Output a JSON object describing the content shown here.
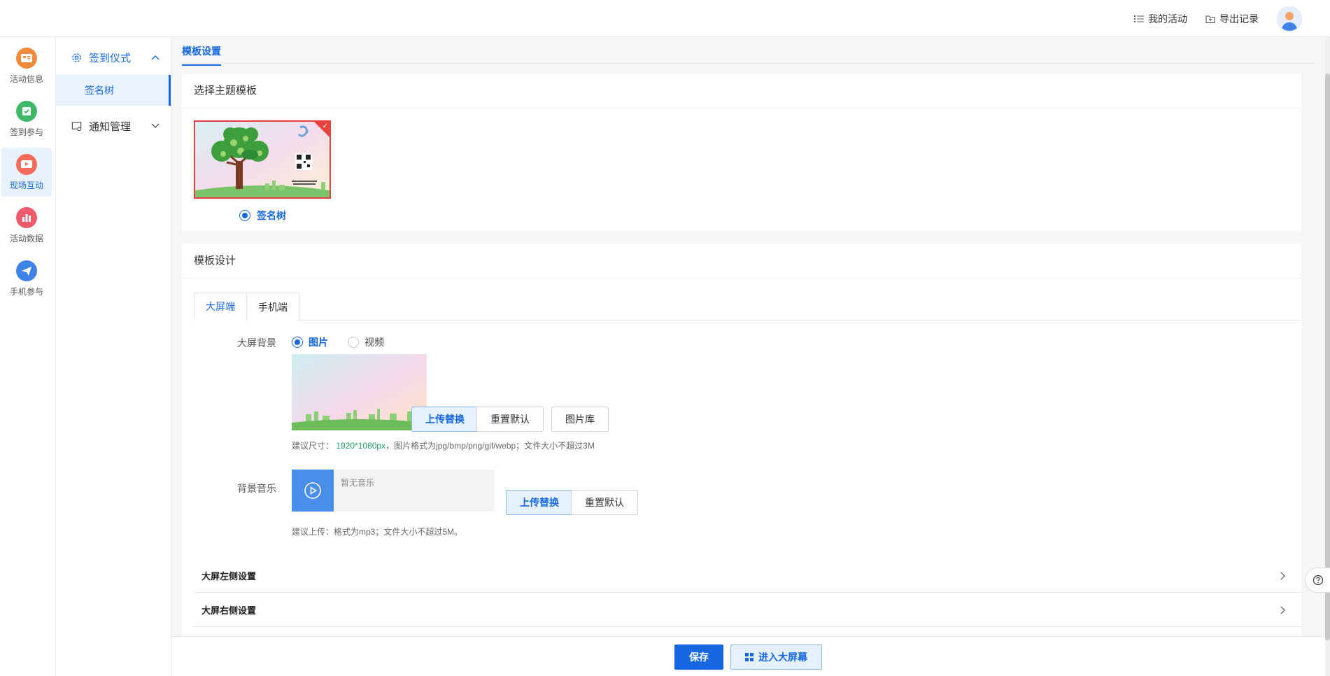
{
  "header": {
    "my_activity": "我的活动",
    "export_record": "导出记录"
  },
  "rail": {
    "items": [
      {
        "label": "活动信息",
        "color": "#f08a3c"
      },
      {
        "label": "签到参与",
        "color": "#3fb86a"
      },
      {
        "label": "现场互动",
        "color": "#f26b5b"
      },
      {
        "label": "活动数据",
        "color": "#ec5a6c"
      },
      {
        "label": "手机参与",
        "color": "#3f82e8"
      }
    ],
    "active_index": 2
  },
  "subnav": {
    "groups": [
      {
        "label": "签到仪式",
        "open": true,
        "items": [
          {
            "label": "签名树"
          }
        ]
      },
      {
        "label": "通知管理",
        "open": false
      }
    ]
  },
  "main": {
    "tab": "模板设置",
    "theme_card": {
      "title": "选择主题模板",
      "template_name": "签名树"
    },
    "design_card": {
      "title": "模板设计",
      "tabs": [
        "大屏端",
        "手机端"
      ],
      "active_tab": 0,
      "bg_label": "大屏背景",
      "bg_options": [
        "图片",
        "视频"
      ],
      "bg_selected": 0,
      "upload_replace": "上传替换",
      "reset_default": "重置默认",
      "gallery": "图片库",
      "bg_hint_prefix": "建议尺寸：",
      "bg_hint_size": "1920*1080px",
      "bg_hint_rest": "，图片格式为jpg/bmp/png/gif/webp；文件大小不超过3M",
      "music_label": "背景音乐",
      "music_placeholder": "暂无音乐",
      "music_hint": "建议上传：格式为mp3；文件大小不超过5M。",
      "left_settings": "大屏左侧设置",
      "right_settings": "大屏右侧设置"
    }
  },
  "footer": {
    "save": "保存",
    "enter_screen": "进入大屏幕"
  },
  "colors": {
    "primary": "#1768e0",
    "selected_border": "#e8423f"
  }
}
